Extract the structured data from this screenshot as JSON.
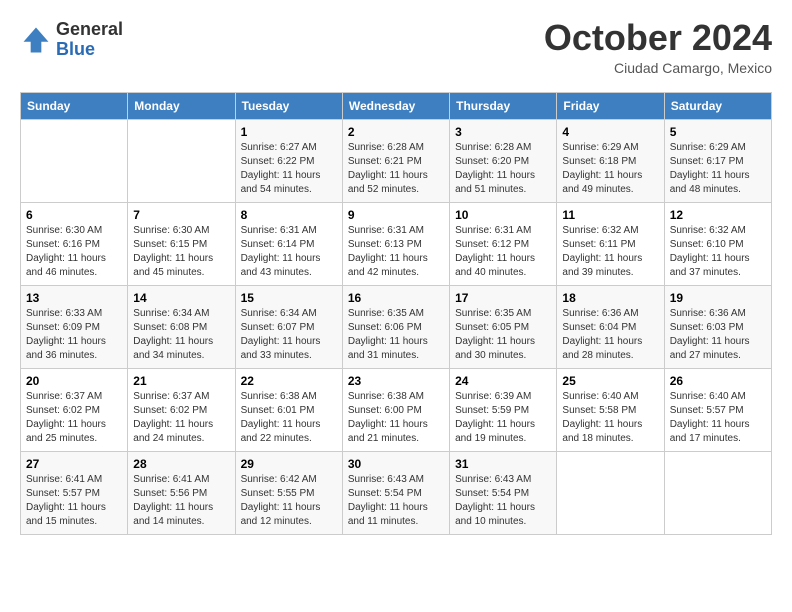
{
  "logo": {
    "general": "General",
    "blue": "Blue"
  },
  "header": {
    "month": "October 2024",
    "location": "Ciudad Camargo, Mexico"
  },
  "days_of_week": [
    "Sunday",
    "Monday",
    "Tuesday",
    "Wednesday",
    "Thursday",
    "Friday",
    "Saturday"
  ],
  "weeks": [
    [
      {
        "day": "",
        "info": ""
      },
      {
        "day": "",
        "info": ""
      },
      {
        "day": "1",
        "sunrise": "6:27 AM",
        "sunset": "6:22 PM",
        "daylight": "11 hours and 54 minutes."
      },
      {
        "day": "2",
        "sunrise": "6:28 AM",
        "sunset": "6:21 PM",
        "daylight": "11 hours and 52 minutes."
      },
      {
        "day": "3",
        "sunrise": "6:28 AM",
        "sunset": "6:20 PM",
        "daylight": "11 hours and 51 minutes."
      },
      {
        "day": "4",
        "sunrise": "6:29 AM",
        "sunset": "6:18 PM",
        "daylight": "11 hours and 49 minutes."
      },
      {
        "day": "5",
        "sunrise": "6:29 AM",
        "sunset": "6:17 PM",
        "daylight": "11 hours and 48 minutes."
      }
    ],
    [
      {
        "day": "6",
        "sunrise": "6:30 AM",
        "sunset": "6:16 PM",
        "daylight": "11 hours and 46 minutes."
      },
      {
        "day": "7",
        "sunrise": "6:30 AM",
        "sunset": "6:15 PM",
        "daylight": "11 hours and 45 minutes."
      },
      {
        "day": "8",
        "sunrise": "6:31 AM",
        "sunset": "6:14 PM",
        "daylight": "11 hours and 43 minutes."
      },
      {
        "day": "9",
        "sunrise": "6:31 AM",
        "sunset": "6:13 PM",
        "daylight": "11 hours and 42 minutes."
      },
      {
        "day": "10",
        "sunrise": "6:31 AM",
        "sunset": "6:12 PM",
        "daylight": "11 hours and 40 minutes."
      },
      {
        "day": "11",
        "sunrise": "6:32 AM",
        "sunset": "6:11 PM",
        "daylight": "11 hours and 39 minutes."
      },
      {
        "day": "12",
        "sunrise": "6:32 AM",
        "sunset": "6:10 PM",
        "daylight": "11 hours and 37 minutes."
      }
    ],
    [
      {
        "day": "13",
        "sunrise": "6:33 AM",
        "sunset": "6:09 PM",
        "daylight": "11 hours and 36 minutes."
      },
      {
        "day": "14",
        "sunrise": "6:34 AM",
        "sunset": "6:08 PM",
        "daylight": "11 hours and 34 minutes."
      },
      {
        "day": "15",
        "sunrise": "6:34 AM",
        "sunset": "6:07 PM",
        "daylight": "11 hours and 33 minutes."
      },
      {
        "day": "16",
        "sunrise": "6:35 AM",
        "sunset": "6:06 PM",
        "daylight": "11 hours and 31 minutes."
      },
      {
        "day": "17",
        "sunrise": "6:35 AM",
        "sunset": "6:05 PM",
        "daylight": "11 hours and 30 minutes."
      },
      {
        "day": "18",
        "sunrise": "6:36 AM",
        "sunset": "6:04 PM",
        "daylight": "11 hours and 28 minutes."
      },
      {
        "day": "19",
        "sunrise": "6:36 AM",
        "sunset": "6:03 PM",
        "daylight": "11 hours and 27 minutes."
      }
    ],
    [
      {
        "day": "20",
        "sunrise": "6:37 AM",
        "sunset": "6:02 PM",
        "daylight": "11 hours and 25 minutes."
      },
      {
        "day": "21",
        "sunrise": "6:37 AM",
        "sunset": "6:02 PM",
        "daylight": "11 hours and 24 minutes."
      },
      {
        "day": "22",
        "sunrise": "6:38 AM",
        "sunset": "6:01 PM",
        "daylight": "11 hours and 22 minutes."
      },
      {
        "day": "23",
        "sunrise": "6:38 AM",
        "sunset": "6:00 PM",
        "daylight": "11 hours and 21 minutes."
      },
      {
        "day": "24",
        "sunrise": "6:39 AM",
        "sunset": "5:59 PM",
        "daylight": "11 hours and 19 minutes."
      },
      {
        "day": "25",
        "sunrise": "6:40 AM",
        "sunset": "5:58 PM",
        "daylight": "11 hours and 18 minutes."
      },
      {
        "day": "26",
        "sunrise": "6:40 AM",
        "sunset": "5:57 PM",
        "daylight": "11 hours and 17 minutes."
      }
    ],
    [
      {
        "day": "27",
        "sunrise": "6:41 AM",
        "sunset": "5:57 PM",
        "daylight": "11 hours and 15 minutes."
      },
      {
        "day": "28",
        "sunrise": "6:41 AM",
        "sunset": "5:56 PM",
        "daylight": "11 hours and 14 minutes."
      },
      {
        "day": "29",
        "sunrise": "6:42 AM",
        "sunset": "5:55 PM",
        "daylight": "11 hours and 12 minutes."
      },
      {
        "day": "30",
        "sunrise": "6:43 AM",
        "sunset": "5:54 PM",
        "daylight": "11 hours and 11 minutes."
      },
      {
        "day": "31",
        "sunrise": "6:43 AM",
        "sunset": "5:54 PM",
        "daylight": "11 hours and 10 minutes."
      },
      {
        "day": "",
        "info": ""
      },
      {
        "day": "",
        "info": ""
      }
    ]
  ]
}
